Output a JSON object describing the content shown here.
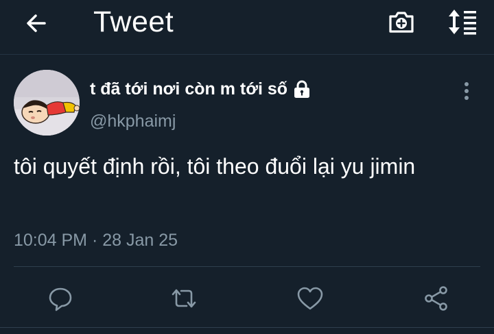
{
  "header": {
    "title": "Tweet",
    "back_icon": "arrow-left-icon",
    "camera_icon": "camera-plus-icon",
    "sort_icon": "sort-icon"
  },
  "tweet": {
    "display_name": "t đã tới nơi còn m tới số",
    "handle": "@hkphaimj",
    "protected_icon": "lock-icon",
    "text": "tôi quyết định rồi, tôi theo đuổi lại yu jimin",
    "timestamp": "10:04 PM · 28 Jan 25"
  },
  "actions": {
    "reply_icon": "reply-icon",
    "retweet_icon": "retweet-icon",
    "like_icon": "heart-icon",
    "share_icon": "share-icon"
  },
  "colors": {
    "background": "#15202b",
    "primary_text": "#ffffff",
    "secondary_text": "#8899a6",
    "divider": "#2f3f4e"
  }
}
